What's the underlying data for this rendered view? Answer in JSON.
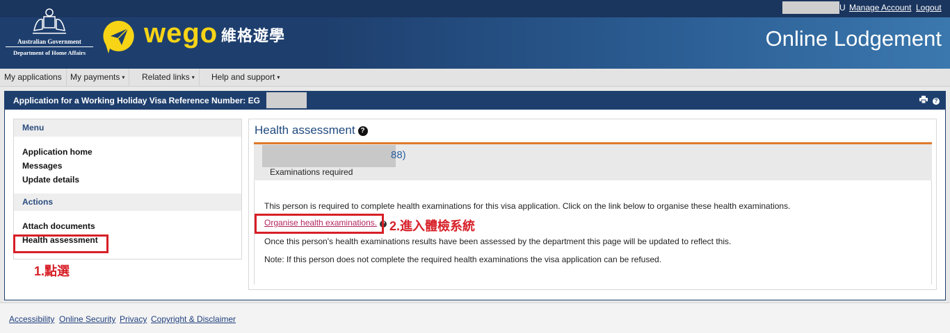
{
  "header": {
    "govt_line1": "Australian Government",
    "govt_line2": "Department of Home Affairs",
    "wego_brand": "wego",
    "wego_chinese": "維格遊學",
    "user_suffix": "U",
    "manage_account": "Manage Account",
    "logout": "Logout",
    "app_title": "Online Lodgement"
  },
  "nav": {
    "my_applications": "My applications",
    "my_payments": "My payments",
    "related_links": "Related links",
    "help_support": "Help and support",
    "caret": "▾"
  },
  "panel": {
    "title": "Application for a Working Holiday Visa Reference Number: EG"
  },
  "sidebar": {
    "menu_heading": "Menu",
    "menu_items": [
      "Application home",
      "Messages",
      "Update details"
    ],
    "actions_heading": "Actions",
    "action_items": [
      "Attach documents",
      "Health assessment"
    ],
    "annotation": "1.點選"
  },
  "content": {
    "title": "Health assessment",
    "person_id_suffix": "88)",
    "person_status": "Examinations required",
    "para1": "This person is required to complete health examinations for this visa application. Click on the link below to organise these health examinations.",
    "organise_link": "Organise health examinations.",
    "annotation": "2.進入體檢系統",
    "para2": "Once this person's health examinations results have been assessed by the department this page will be updated to reflect this.",
    "para3": "Note: If this person does not complete the required health examinations the visa application can be refused."
  },
  "footer": {
    "links": [
      "Accessibility",
      "Online Security",
      "Privacy",
      "Copyright & Disclaimer"
    ]
  },
  "colors": {
    "header_bg": "#1e3f6e",
    "wego_yellow": "#f7d416",
    "highlight_red": "#d71f27",
    "link_color": "#b3245e",
    "accent_orange": "#e07a2b"
  }
}
